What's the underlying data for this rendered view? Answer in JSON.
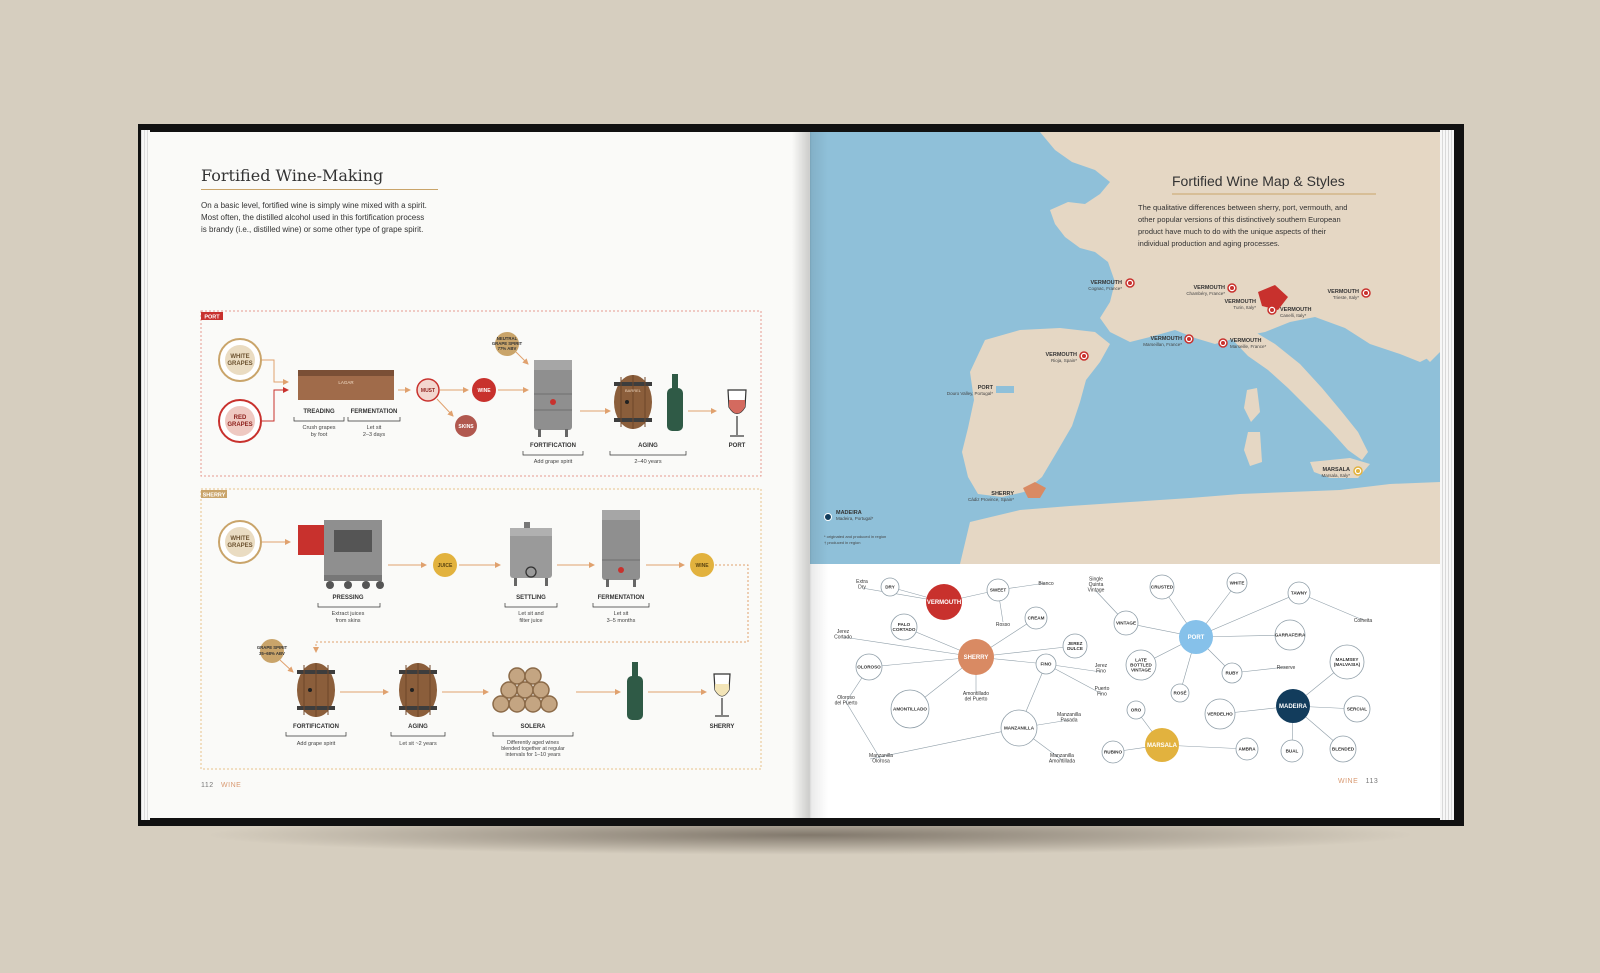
{
  "left_page": {
    "title": "Fortified Wine-Making",
    "intro": [
      "On a basic level, fortified wine is simply wine mixed with a spirit.",
      "Most often, the distilled alcohol used in this fortification process",
      "is brandy (i.e., distilled wine) or some other type of grape spirit."
    ],
    "page_number": "112",
    "running_head": "WINE",
    "port": {
      "tag": "PORT",
      "white_grapes": [
        "WHITE",
        "GRAPES"
      ],
      "red_grapes": [
        "RED",
        "GRAPES"
      ],
      "lagar": "LAGAR",
      "treading": "TREADING",
      "treading_note": [
        "Crush grapes",
        "by foot"
      ],
      "fermentation": "FERMENTATION",
      "fermentation_note": [
        "Let sit",
        "2–3 days"
      ],
      "must": "MUST",
      "wine": "WINE",
      "skins": "SKINS",
      "neutral_spirit": [
        "NEUTRAL",
        "GRAPE SPIRIT",
        "77% ABV"
      ],
      "fortification": "FORTIFICATION",
      "fortification_note": "Add grape spirit",
      "barrel": "BARREL",
      "aging": "AGING",
      "aging_note": "2–40 years",
      "result": "PORT"
    },
    "sherry": {
      "tag": "SHERRY",
      "white_grapes": [
        "WHITE",
        "GRAPES"
      ],
      "pressing": "PRESSING",
      "pressing_note": [
        "Extract juices",
        "from skins"
      ],
      "juice": "JUICE",
      "settling": "SETTLING",
      "settling_note": [
        "Let sit and",
        "filter juice"
      ],
      "fermentation": "FERMENTATION",
      "fermentation_note": [
        "Let sit",
        "3–5 months"
      ],
      "wine": "WINE",
      "grape_spirit": [
        "GRAPE SPIRIT",
        "35–68% ABV"
      ],
      "fortification": "FORTIFICATION",
      "fortification_note": "Add grape spirit",
      "aging": "AGING",
      "aging_note": "Let sit ~2 years",
      "solera": "SOLERA",
      "solera_note": [
        "Differently aged wines",
        "blended together at regular",
        "intervals for 1–10 years"
      ],
      "result": "SHERRY"
    }
  },
  "right_page": {
    "title": "Fortified Wine Map & Styles",
    "intro": [
      "The qualitative differences between sherry, port, vermouth, and",
      "other popular versions of this distinctively southern European",
      "product have much to do with the unique aspects of their",
      "individual production and aging processes."
    ],
    "page_number": "113",
    "running_head": "WINE",
    "map_labels": [
      {
        "name": "VERMOUTH",
        "place": "Cognac, France*"
      },
      {
        "name": "VERMOUTH",
        "place": "Chambéry, France*"
      },
      {
        "name": "VERMOUTH",
        "place": "Turin, Italy*"
      },
      {
        "name": "VERMOUTH",
        "place": "Canelli, Italy*"
      },
      {
        "name": "VERMOUTH",
        "place": "Trieste, Italy*"
      },
      {
        "name": "VERMOUTH",
        "place": "Marseillan, France*"
      },
      {
        "name": "VERMOUTH",
        "place": "Marseille, France*"
      },
      {
        "name": "VERMOUTH",
        "place": "Rioja, Spain*"
      },
      {
        "name": "PORT",
        "place": "Douro Valley, Portugal*"
      },
      {
        "name": "SHERRY",
        "place": "Cádiz Province, Spain*"
      },
      {
        "name": "MARSALA",
        "place": "Marsala, Italy*"
      },
      {
        "name": "MADEIRA",
        "place": "Madeira, Portugal*"
      }
    ],
    "footnotes": [
      "* originated and produced in region",
      "† produced in region"
    ],
    "styles": {
      "vermouth": "VERMOUTH",
      "sherry": "SHERRY",
      "port": "PORT",
      "madeira": "MADEIRA",
      "marsala": "MARSALA",
      "dry": "DRY",
      "sweet": "SWEET",
      "extra_dry": [
        "Extra",
        "Dry"
      ],
      "bianco": "Bianco",
      "rosso": "Rosso",
      "palo_cortado": [
        "PALO",
        "CORTADO"
      ],
      "cream": "CREAM",
      "jerez_cortado": [
        "Jerez",
        "Cortado"
      ],
      "jerez_dulce": [
        "JEREZ",
        "DULCE"
      ],
      "oloroso": "OLOROSO",
      "fino": "FINO",
      "jerez_fino": [
        "Jerez",
        "Fino"
      ],
      "puerto_fino": [
        "Puerto",
        "Fino"
      ],
      "amontillado": "AMONTILLADO",
      "amontillado_puerto": [
        "Amontillado",
        "del Puerto"
      ],
      "manzanilla": "MANZANILLA",
      "manzanilla_pasada": [
        "Manzanilla",
        "Pasada"
      ],
      "manzanilla_amontillada": [
        "Manzanilla",
        "Amontillada"
      ],
      "oloroso_puerto": [
        "Oloroso",
        "del Puerto"
      ],
      "manzanilla_olorosa": [
        "Manzanilla",
        "Olorosa"
      ],
      "single_quinta": [
        "Single",
        "Quinta",
        "Vintage"
      ],
      "crusted": "CRUSTED",
      "white": "WHITE",
      "tawny": "TAWNY",
      "colheita": "Colheita",
      "vintage": "VINTAGE",
      "garrafeira": "GARRAFEIRA",
      "lbv": [
        "LATE",
        "BOTTLED",
        "VINTAGE"
      ],
      "ruby": "RUBY",
      "reserve": "Reserve",
      "rose": "ROSÉ",
      "malmsey": [
        "MALMSEY",
        "(MALVASIA)"
      ],
      "verdelho": "VERDELHO",
      "sercial": "SERCIAL",
      "oro": "ORO",
      "bual": "BUAL",
      "blended": "BLENDED",
      "rubino": "RUBINO",
      "ambra": "AMBRA"
    }
  },
  "colors": {
    "vermouth": "#c8312d",
    "sherry": "#d98a63",
    "port": "#86c1ea",
    "madeira": "#123c5c",
    "marsala": "#e2b23e",
    "sea": "#8fc0d9",
    "land": "#e5d7c4",
    "gold": "#c9a46a",
    "red": "#c8312d"
  }
}
